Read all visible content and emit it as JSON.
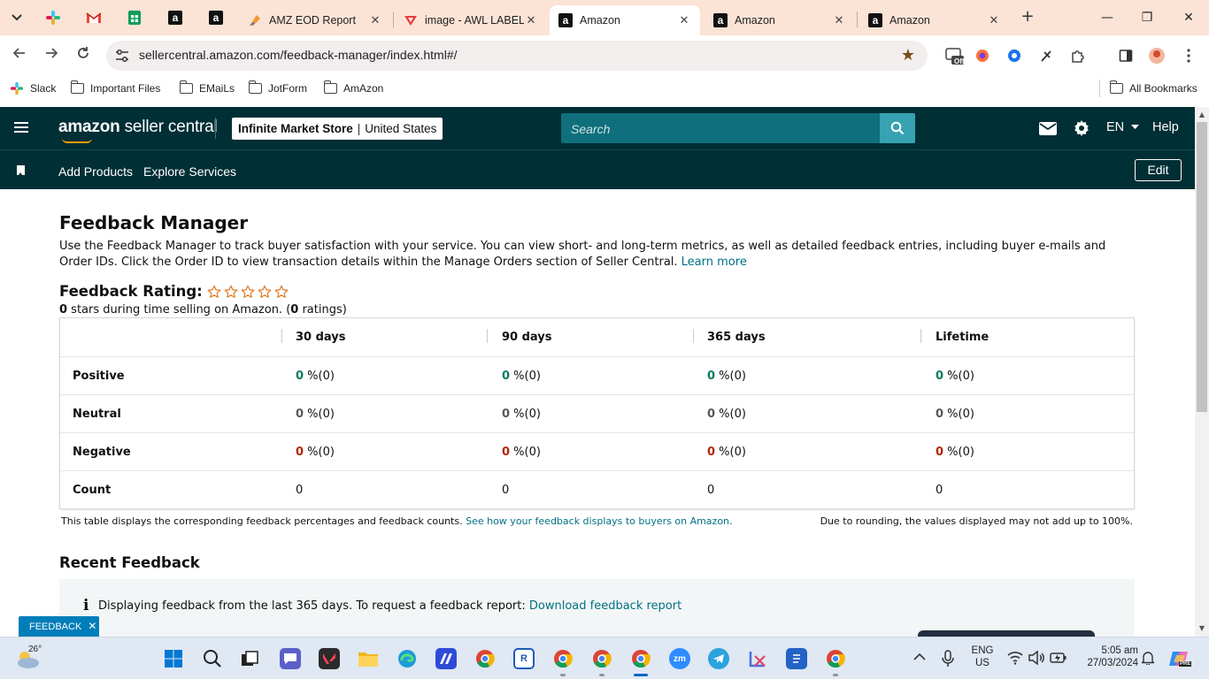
{
  "browser": {
    "tabs": [
      {
        "label": "AMZ EOD Report",
        "icon": "zoho-icon"
      },
      {
        "label": "image - AWL LABEL",
        "icon": "vivaldi-icon"
      },
      {
        "label": "Amazon",
        "icon": "amazon-icon"
      },
      {
        "label": "Amazon",
        "icon": "amazon-icon"
      },
      {
        "label": "Amazon",
        "icon": "amazon-icon"
      }
    ],
    "pinned_tabs": [
      "slack-icon",
      "gmail-icon",
      "sheets-icon",
      "amazon-icon",
      "amazon-icon"
    ],
    "close_glyph": "✕",
    "new_tab_glyph": "+",
    "window_controls": {
      "minimize": "—",
      "restore": "❐",
      "close": "✕"
    },
    "url": "sellercentral.amazon.com/feedback-manager/index.html#/",
    "bookmarks": [
      "Slack",
      "Important Files",
      "EMaiLs",
      "JotForm",
      "AmAzon"
    ],
    "all_bookmarks": "All Bookmarks",
    "ext_off_badge": "Off"
  },
  "header": {
    "logo_bold": "amazon",
    "logo_rest": " seller central",
    "store_name": "Infinite Market Store",
    "marketplace": "United States",
    "search_placeholder": "Search",
    "language": "EN",
    "help": "Help",
    "nav_links": [
      "Add Products",
      "Explore Services"
    ],
    "edit": "Edit"
  },
  "content": {
    "title": "Feedback Manager",
    "intro": "Use the Feedback Manager to track buyer satisfaction with your service. You can view short- and long-term metrics, as well as detailed feedback entries, including buyer e-mails and Order IDs. Click the Order ID to view transaction details within the Manage Orders section of Seller Central.",
    "learn_more": "Learn more",
    "rating_label": "Feedback Rating:",
    "stars_value": 0,
    "stars_max": 5,
    "rating_stars": "0",
    "rating_mid": " stars during time selling on Amazon. (",
    "rating_count": "0",
    "rating_end": " ratings)",
    "table": {
      "columns": [
        "30 days",
        "90 days",
        "365 days",
        "Lifetime"
      ],
      "rows": [
        {
          "label": "Positive",
          "cells": [
            {
              "value": "0",
              "rest": " %(0)"
            },
            {
              "value": "0",
              "rest": " %(0)"
            },
            {
              "value": "0",
              "rest": " %(0)"
            },
            {
              "value": "0",
              "rest": " %(0)"
            }
          ]
        },
        {
          "label": "Neutral",
          "cells": [
            {
              "value": "0",
              "rest": " %(0)"
            },
            {
              "value": "0",
              "rest": " %(0)"
            },
            {
              "value": "0",
              "rest": " %(0)"
            },
            {
              "value": "0",
              "rest": " %(0)"
            }
          ]
        },
        {
          "label": "Negative",
          "cells": [
            {
              "value": "0",
              "rest": " %(0)"
            },
            {
              "value": "0",
              "rest": " %(0)"
            },
            {
              "value": "0",
              "rest": " %(0)"
            },
            {
              "value": "0",
              "rest": " %(0)"
            }
          ]
        },
        {
          "label": "Count",
          "cells": [
            {
              "value": "0",
              "rest": ""
            },
            {
              "value": "0",
              "rest": ""
            },
            {
              "value": "0",
              "rest": ""
            },
            {
              "value": "0",
              "rest": ""
            }
          ]
        }
      ]
    },
    "note_left": "This table displays the corresponding feedback percentages and feedback counts.",
    "note_link": "See how your feedback displays to buyers on Amazon.",
    "note_right": "Due to rounding, the values displayed may not add up to 100%.",
    "recent_title": "Recent Feedback",
    "info_icon": "i",
    "info_text": "Displaying feedback from the last 365 days. To request a feedback report:",
    "info_link": "Download feedback report",
    "feedback_tab": "FEEDBACK",
    "feedback_tab_close": "✕"
  },
  "taskbar": {
    "temperature": "26°",
    "lang_line1": "ENG",
    "lang_line2": "US",
    "time": "5:05 am",
    "date": "27/03/2024",
    "badge": "PRE"
  },
  "colors": {
    "header_bg": "#002f36",
    "link": "#007185",
    "positive": "#067d62",
    "negative": "#b12704",
    "feedback_tab": "#007eb9"
  }
}
